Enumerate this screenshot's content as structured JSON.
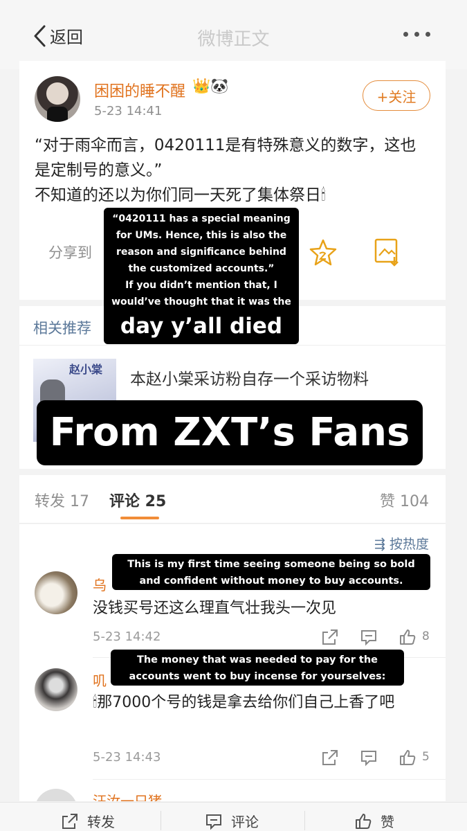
{
  "header": {
    "back_label": "返回",
    "title": "微博正文"
  },
  "post": {
    "username": "困困的睡不醒",
    "badges": "👑🐼",
    "time": "5-23 14:41",
    "follow_label": "+关注",
    "text_line1": "“对于雨伞而言，0420111是有特殊意义的数字，这也是定制号的意义。”",
    "text_line2": "不知道的还以为你们同一天死了集体祭日🕯",
    "share_label": "分享到"
  },
  "related": {
    "header": "相关推荐",
    "thumb_text": "赵小棠",
    "title": "本赵小棠采访粉自存一个采访物料"
  },
  "tabs": {
    "repost": "转发 17",
    "comments": "评论 25",
    "likes": "赞 104"
  },
  "comments": {
    "sort_label": "按热度",
    "items": [
      {
        "name": "乌",
        "text": "没钱买号还这么理直气壮我头一次见",
        "time": "5-23 14:42",
        "likes": "8"
      },
      {
        "name": "叽",
        "text": "🕯那7000个号的钱是拿去给你们自己上香了吧",
        "time": "5-23 14:43",
        "likes": "5"
      },
      {
        "name": "汪汝一只猪"
      }
    ]
  },
  "bottombar": {
    "repost": "转发",
    "comment": "评论",
    "like": "赞"
  },
  "overlays": {
    "ov1_lines": [
      "“0420111 has a special meaning",
      "for UMs. Hence, this is also the",
      "reason and significance behind",
      "the customized accounts.”",
      "If you didn’t mention that, I",
      "would’ve thought that it was the"
    ],
    "ov1_big": "day y’all died",
    "ov2": "From ZXT’s Fans",
    "ov3_line1": "This is my first time seeing someone being so bold",
    "ov3_line2": "and confident without money to buy accounts.",
    "ov4_line1": "The money that was needed to pay for the",
    "ov4_line2": "accounts went to buy incense for yourselves:"
  },
  "colors": {
    "accent_orange": "#e0721d",
    "link_blue": "#5b7899",
    "tab_underline": "#f18d38"
  }
}
